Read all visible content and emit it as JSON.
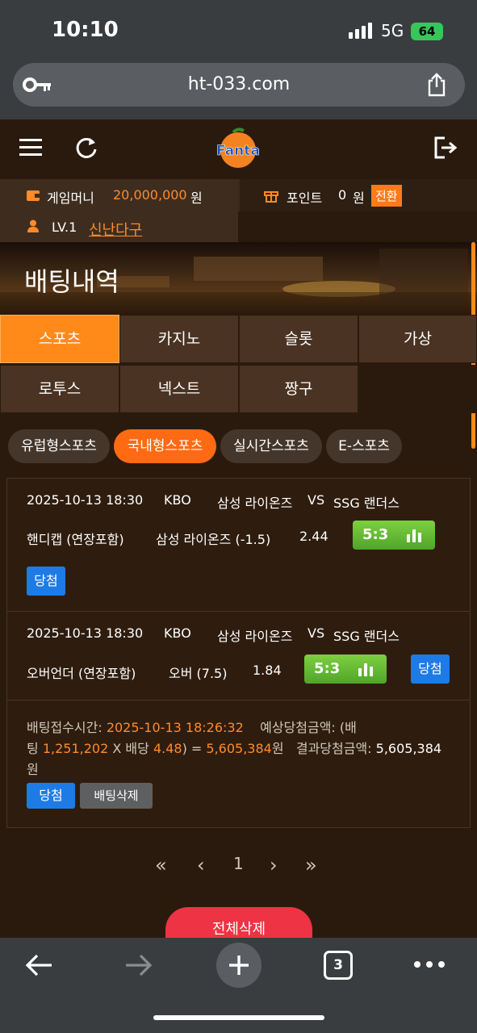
{
  "status": {
    "time": "10:10",
    "network": "5G",
    "battery": "64"
  },
  "browser": {
    "url": "ht-033.com",
    "tab_count": "3"
  },
  "header": {
    "logo_text": "Fanta"
  },
  "account": {
    "money_label": "게임머니",
    "money_value": "20,000,000",
    "money_unit": "원",
    "point_label": "포인트",
    "point_value": "0",
    "point_unit": "원",
    "convert_label": "전환",
    "level": "LV.1",
    "nickname": "신난다구"
  },
  "page": {
    "title": "배팅내역"
  },
  "tabs": [
    {
      "label": "스포츠"
    },
    {
      "label": "카지노"
    },
    {
      "label": "슬롯"
    },
    {
      "label": "가상"
    },
    {
      "label": "로투스"
    },
    {
      "label": "넥스트"
    },
    {
      "label": "짱구"
    }
  ],
  "filters": [
    {
      "label": "유럽형스포츠"
    },
    {
      "label": "국내형스포츠"
    },
    {
      "label": "실시간스포츠"
    },
    {
      "label": "E-스포츠"
    }
  ],
  "bets": [
    {
      "datetime": "2025-10-13 18:30",
      "league": "KBO",
      "home": "삼성 라이온즈",
      "vs": "VS",
      "away": "SSG 랜더스",
      "market": "핸디캡 (연장포함)",
      "pick": "삼성 라이온즈 (-1.5)",
      "odds": "2.44",
      "score": "5:3",
      "result": "당첨"
    },
    {
      "datetime": "2025-10-13 18:30",
      "league": "KBO",
      "home": "삼성 라이온즈",
      "vs": "VS",
      "away": "SSG 랜더스",
      "market": "오버언더 (연장포함)",
      "pick": "오버 (7.5)",
      "odds": "1.84",
      "score": "5:3",
      "result": "당첨"
    }
  ],
  "summary": {
    "time_label": "배팅접수시간:",
    "time_value": "2025-10-13 18:26:32",
    "expected_label_a": "예상당첨금액: (배",
    "expected_label_b": "팅",
    "stake": "1,251,202",
    "x_label": "X 배당",
    "total_odds": "4.48",
    "eq": ") =",
    "expected_value": "5,605,384",
    "won": "원",
    "result_label": "결과당첨금액:",
    "result_value": "5,605,384",
    "result_unit": "원",
    "status_btn": "당첨",
    "delete_btn": "배팅삭제"
  },
  "pagination": {
    "first": "«",
    "prev": "‹",
    "current": "1",
    "next": "›",
    "last": "»"
  },
  "delete_all": "전체삭제",
  "colors": {
    "accent": "#ff8a1a",
    "win": "#1e7be6",
    "score": "#5fb833",
    "delete": "#ee3344"
  }
}
